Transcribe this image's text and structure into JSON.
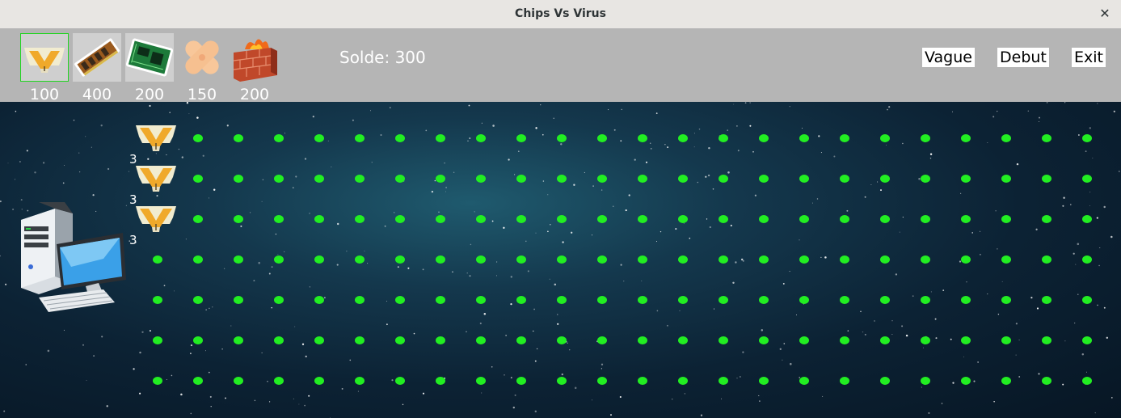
{
  "window": {
    "title": "Chips Vs Virus",
    "close_label": "✕"
  },
  "shop": [
    {
      "name": "chip-v",
      "price": "100",
      "selected": true
    },
    {
      "name": "ram",
      "price": "400"
    },
    {
      "name": "circuit-board",
      "price": "200"
    },
    {
      "name": "bandage",
      "price": "150"
    },
    {
      "name": "firewall",
      "price": "200"
    }
  ],
  "balance": "Solde: 300",
  "menu": {
    "wave": "Vague",
    "start": "Debut",
    "exit": "Exit"
  },
  "board": {
    "rows": 7,
    "columns": 24,
    "cell_color": "#22ee22",
    "defenders": [
      {
        "type": "chip-v",
        "row": 0,
        "col": 0,
        "hp": "3"
      },
      {
        "type": "chip-v",
        "row": 1,
        "col": 0,
        "hp": "3"
      },
      {
        "type": "chip-v",
        "row": 2,
        "col": 0,
        "hp": "3"
      }
    ]
  }
}
